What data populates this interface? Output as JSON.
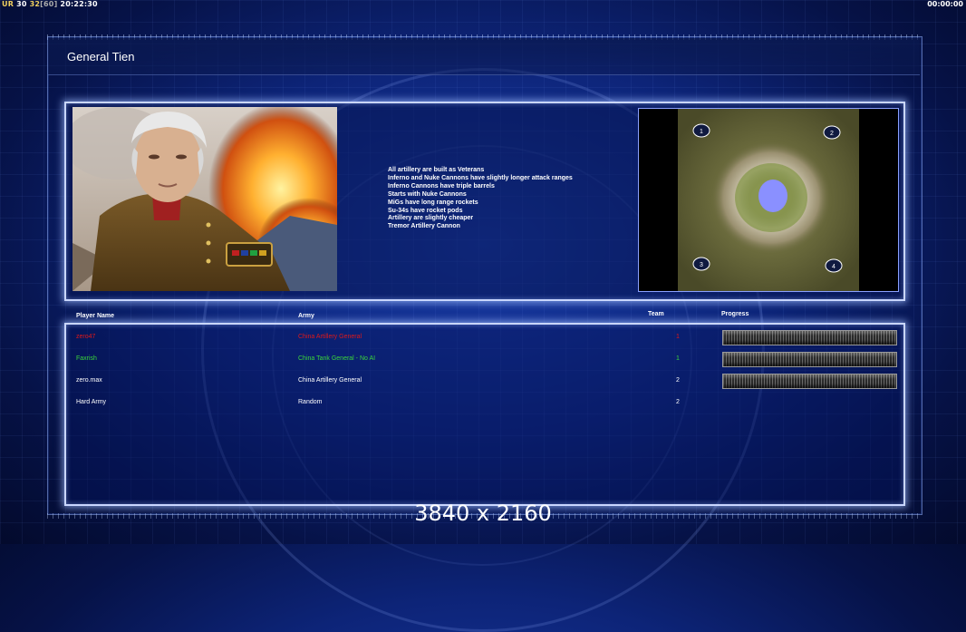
{
  "hud": {
    "ur_label": "UR",
    "ur_value": "30",
    "fps": "32",
    "fps_cap": "60",
    "clock": "20:22:30",
    "timer": "00:00:00"
  },
  "title": "General Tien",
  "general_info": [
    "All artillery are built as Veterans",
    "Inferno and Nuke Cannons have slightly longer attack ranges",
    "Inferno Cannons have triple barrels",
    "Starts with Nuke Cannons",
    "MiGs have long range rockets",
    "Su-34s have rocket pods",
    "Artillery are slightly cheaper",
    "Tremor Artillery Cannon"
  ],
  "map": {
    "start_positions": [
      "1",
      "2",
      "3",
      "4"
    ]
  },
  "table": {
    "headers": {
      "player_name": "Player Name",
      "army": "Army",
      "team": "Team",
      "progress": "Progress"
    },
    "rows": [
      {
        "name": "zero47",
        "army": "China Artillery General",
        "team": "1",
        "color": "#e01818",
        "team_color": "#e01818",
        "progress": 1.0
      },
      {
        "name": "Faxrish",
        "army": "China Tank General - No AI",
        "team": "1",
        "color": "#3ad63a",
        "team_color": "#3ad63a",
        "progress": 1.0
      },
      {
        "name": "zero.max",
        "army": "China Artillery General",
        "team": "2",
        "color": "#ffffff",
        "team_color": "#ffffff",
        "progress": 1.0
      },
      {
        "name": "Hard Army",
        "army": "Random",
        "team": "2",
        "color": "#ffffff",
        "team_color": "#ffffff",
        "progress": null
      }
    ]
  },
  "resolution_label": "3840 x 2160"
}
